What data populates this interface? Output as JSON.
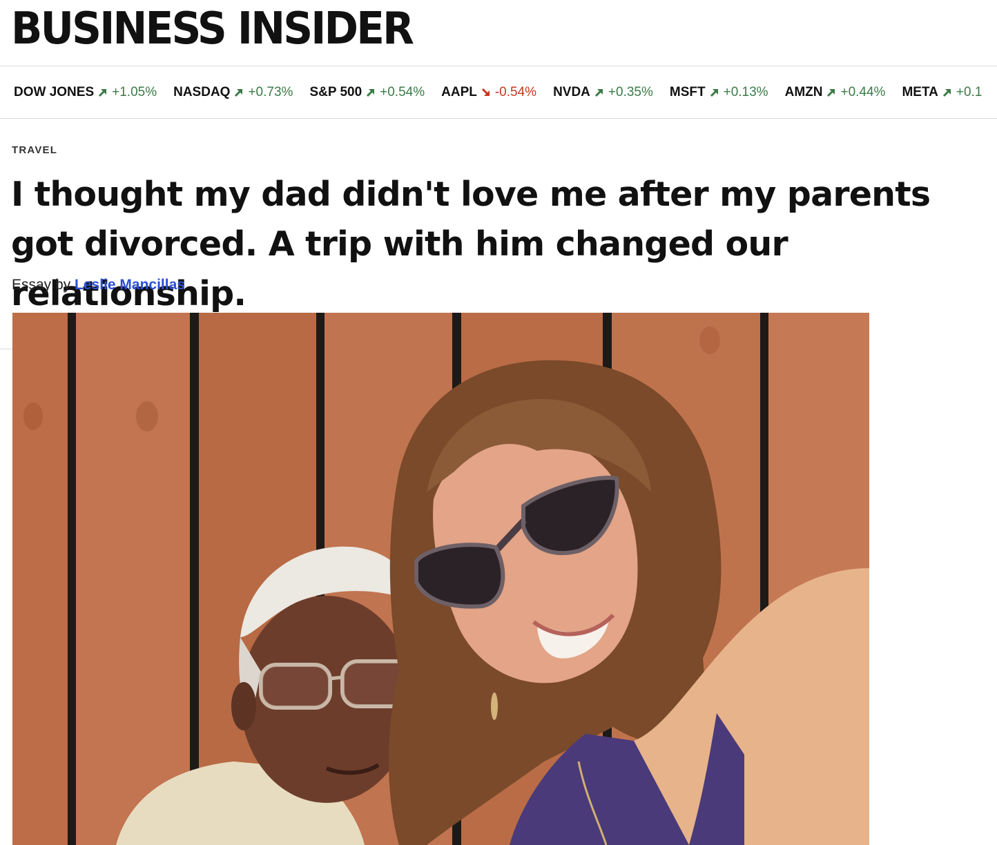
{
  "brand": {
    "logo_text": "BUSINESS INSIDER"
  },
  "ticker": [
    {
      "name": "DOW JONES",
      "change": "+1.05%",
      "direction": "up"
    },
    {
      "name": "NASDAQ",
      "change": "+0.73%",
      "direction": "up"
    },
    {
      "name": "S&P 500",
      "change": "+0.54%",
      "direction": "up"
    },
    {
      "name": "AAPL",
      "change": "-0.54%",
      "direction": "down"
    },
    {
      "name": "NVDA",
      "change": "+0.35%",
      "direction": "up"
    },
    {
      "name": "MSFT",
      "change": "+0.13%",
      "direction": "up"
    },
    {
      "name": "AMZN",
      "change": "+0.44%",
      "direction": "up"
    },
    {
      "name": "META",
      "change": "+0.1",
      "direction": "up"
    }
  ],
  "colors": {
    "up": "#3a7a47",
    "down": "#c4371f",
    "author_link": "#2a4fd6"
  },
  "article": {
    "category": "TRAVEL",
    "headline": "I thought my dad didn't love me after my parents got divorced. A trip with him changed our relationship.",
    "byline_prefix": "Essay by",
    "author": "Leslie Mancillas"
  }
}
